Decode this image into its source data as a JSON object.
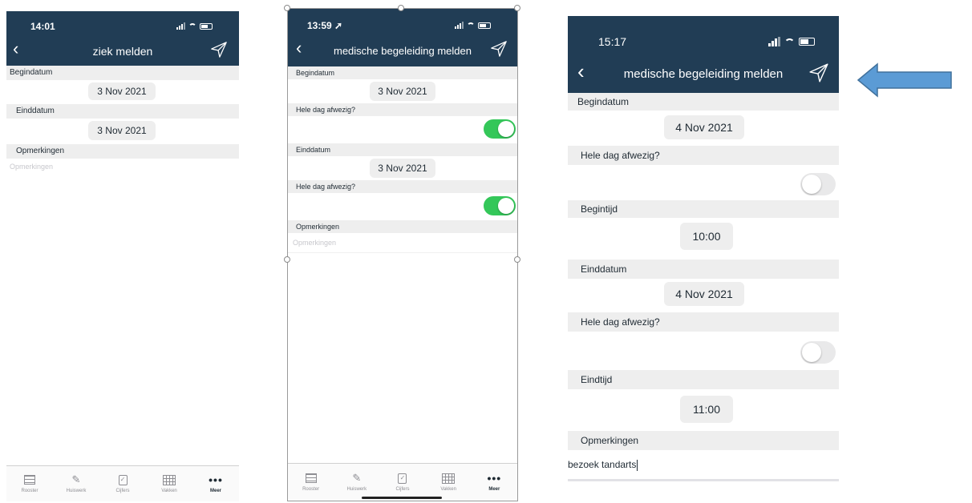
{
  "colors": {
    "header": "#213d55",
    "section": "#eeeeee",
    "toggle_on": "#34c759",
    "toggle_off": "#e9e9ea",
    "arrow": "#5b9bd5"
  },
  "screen1": {
    "time": "14:01",
    "title": "ziek melden",
    "begin_label": "Begindatum",
    "begin_date": "3 Nov 2021",
    "end_label": "Einddatum",
    "end_date": "3 Nov 2021",
    "remarks_label": "Opmerkingen",
    "remarks_placeholder": "Opmerkingen",
    "tabs": [
      {
        "label": "Rooster",
        "icon": "calendar-icon"
      },
      {
        "label": "Huiswerk",
        "icon": "pencil-icon"
      },
      {
        "label": "Cijfers",
        "icon": "checkbox-icon"
      },
      {
        "label": "Vakken",
        "icon": "grid-icon"
      },
      {
        "label": "Meer",
        "icon": "more-icon",
        "glyph": "•••",
        "active": true
      }
    ]
  },
  "screen2": {
    "time": "13:59",
    "title": "medische begeleiding melden",
    "begin_label": "Begindatum",
    "begin_date": "3 Nov 2021",
    "allday_label_1": "Hele dag afwezig?",
    "allday_1": true,
    "end_label": "Einddatum",
    "end_date": "3 Nov 2021",
    "allday_label_2": "Hele dag afwezig?",
    "allday_2": true,
    "remarks_label": "Opmerkingen",
    "remarks_placeholder": "Opmerkingen",
    "tabs": [
      {
        "label": "Rooster",
        "icon": "calendar-icon"
      },
      {
        "label": "Huiswerk",
        "icon": "pencil-icon"
      },
      {
        "label": "Cijfers",
        "icon": "checkbox-icon"
      },
      {
        "label": "Vakken",
        "icon": "grid-icon"
      },
      {
        "label": "Meer",
        "icon": "more-icon",
        "glyph": "•••",
        "active": true
      }
    ]
  },
  "screen3": {
    "time": "15:17",
    "title": "medische begeleiding melden",
    "begin_label": "Begindatum",
    "begin_date": "4 Nov 2021",
    "allday_label_1": "Hele dag afwezig?",
    "allday_1": false,
    "begintime_label": "Begintijd",
    "begin_time": "10:00",
    "end_label": "Einddatum",
    "end_date": "4 Nov 2021",
    "allday_label_2": "Hele dag afwezig?",
    "allday_2": false,
    "endtime_label": "Eindtijd",
    "end_time": "11:00",
    "remarks_label": "Opmerkingen",
    "remarks_value": "bezoek tandarts"
  },
  "icons": {
    "back": "‹",
    "send": "paper-plane-icon",
    "arrow": "left-arrow-icon"
  }
}
